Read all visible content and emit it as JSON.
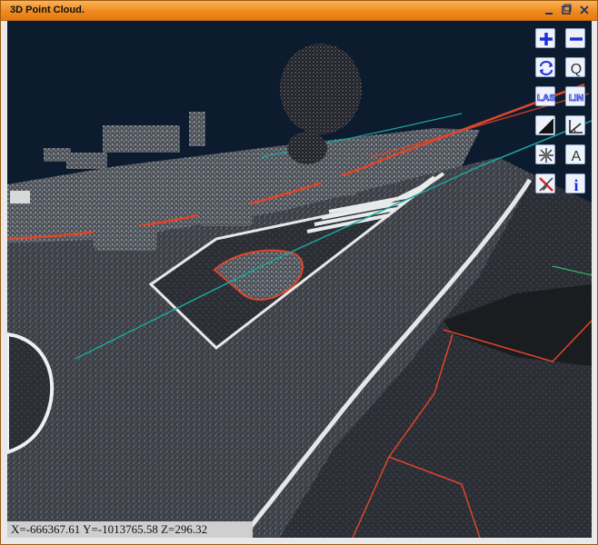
{
  "window": {
    "title": "3D Point Cloud.",
    "controls": [
      "minimize",
      "maximize",
      "close"
    ]
  },
  "toolbar": [
    {
      "id": "zoom-in",
      "icon": "plus-icon"
    },
    {
      "id": "zoom-out",
      "icon": "minus-icon"
    },
    {
      "id": "rotate",
      "icon": "rotate-icon"
    },
    {
      "id": "query",
      "icon": "q-icon",
      "label": "Q"
    },
    {
      "id": "las",
      "icon": "las-icon",
      "label": "LAS"
    },
    {
      "id": "lin",
      "icon": "lin-icon",
      "label": "LIN"
    },
    {
      "id": "shade",
      "icon": "contrast-icon"
    },
    {
      "id": "angle",
      "icon": "angle-icon"
    },
    {
      "id": "explode",
      "icon": "explode-icon"
    },
    {
      "id": "annotate",
      "icon": "text-a-icon",
      "label": "A"
    },
    {
      "id": "clear",
      "icon": "clear-icon"
    },
    {
      "id": "info",
      "icon": "info-icon",
      "label": "i"
    }
  ],
  "status": {
    "coordinates": "X=-666367.61 Y=-1013765.58 Z=296.32"
  },
  "colors": {
    "titlebar": "#f08a1e",
    "viewport_bg": "#0c1c2e",
    "icon_blue": "#1f2fd8",
    "point_road": "#3a3d44",
    "point_light": "#bfc3c9",
    "breakline_red": "#e0452a",
    "line_teal": "#1aa6a0"
  }
}
